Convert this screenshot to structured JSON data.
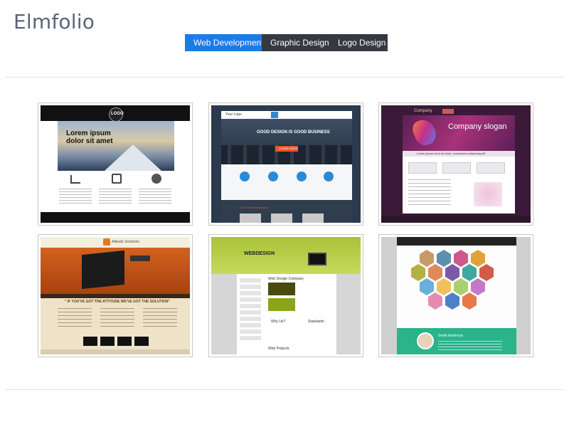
{
  "brand": {
    "title": "Elmfolio"
  },
  "tabs": [
    {
      "label": "Web Development",
      "active": true
    },
    {
      "label": "Graphic Design",
      "active": false
    },
    {
      "label": "Logo Design",
      "active": false
    }
  ],
  "colors": {
    "active_tab": "#1d7be6",
    "inactive_tab": "#343a40",
    "brand_text": "#5b6478"
  },
  "portfolio": {
    "items": [
      {
        "name": "template-logo-mountains",
        "headline": "Lorem ipsum dolor sit amet",
        "logo": "LOGO"
      },
      {
        "name": "template-good-design",
        "logo": "Your Logo",
        "headline": "GOOD DESIGN IS GOOD BUSINESS",
        "button": "LEARN MORE",
        "section": "Our Portfolio Awesome"
      },
      {
        "name": "template-company-slogan",
        "logo": "Company",
        "headline": "Company slogan",
        "tagline": "Lorem ipsum dolor sit amet, consectetur adipiscing elit."
      },
      {
        "name": "template-attitude-solutions",
        "logo": "Attitude Solutions",
        "banner": "\" IF YOU'VE GOT THE ATTITUDE WE'VE GOT THE SOLUTION\""
      },
      {
        "name": "template-web-design",
        "logo": "WEBDESIGN",
        "company": "Web Design Company",
        "why": "Why Us?",
        "standards": "Standards",
        "projects": "Web Projects"
      },
      {
        "name": "template-hexagon-portfolio",
        "person": "Smith Anderson"
      }
    ]
  }
}
